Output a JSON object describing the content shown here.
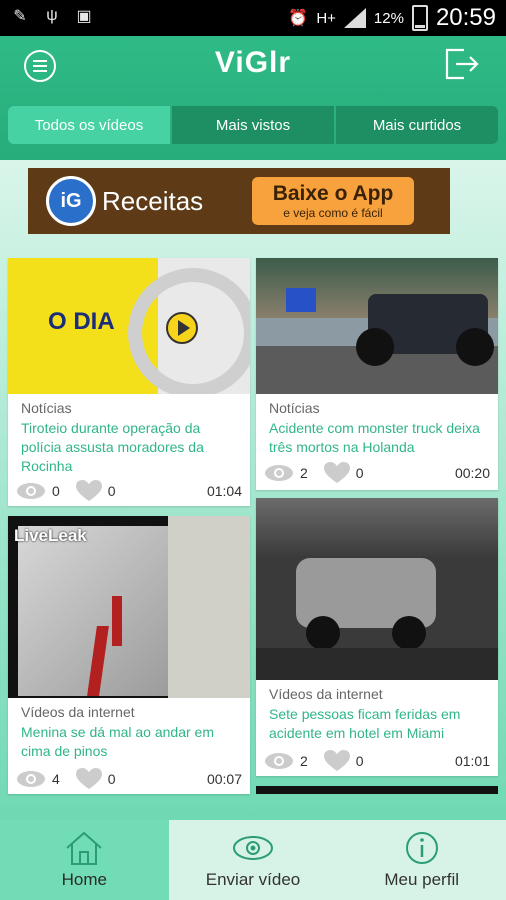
{
  "status": {
    "time": "20:59",
    "battery": "12%",
    "network": "H+"
  },
  "app": {
    "title": "ViGlr"
  },
  "tabs": [
    {
      "label": "Todos os vídeos"
    },
    {
      "label": "Mais vistos"
    },
    {
      "label": "Mais curtidos"
    }
  ],
  "ad": {
    "brand": "Receitas",
    "logo_text": "iG",
    "cta_line1": "Baixe o App",
    "cta_line2": "e veja como é fácil"
  },
  "videos": [
    {
      "thumb_text": "O DIA",
      "category": "Notícias",
      "title": "Tiroteio durante operação da polícia assusta moradores da Rocinha",
      "views": "0",
      "likes": "0",
      "duration": "01:04"
    },
    {
      "category": "Notícias",
      "title": "Acidente com monster truck deixa três mortos na Holanda",
      "views": "2",
      "likes": "0",
      "duration": "00:20"
    },
    {
      "thumb_text": "LiveLeak",
      "category": "Vídeos da internet",
      "title": "Menina se dá mal ao andar em cima de pinos",
      "views": "4",
      "likes": "0",
      "duration": "00:07"
    },
    {
      "category": "Vídeos da internet",
      "title": "Sete pessoas ficam feridas em acidente em hotel em Miami",
      "views": "2",
      "likes": "0",
      "duration": "01:01"
    }
  ],
  "bottom_nav": [
    {
      "label": "Home",
      "icon": "home-icon"
    },
    {
      "label": "Enviar vídeo",
      "icon": "eye-icon"
    },
    {
      "label": "Meu perfil",
      "icon": "info-icon"
    }
  ],
  "colors": {
    "primary": "#2fbb86",
    "accent_text": "#30b687"
  }
}
